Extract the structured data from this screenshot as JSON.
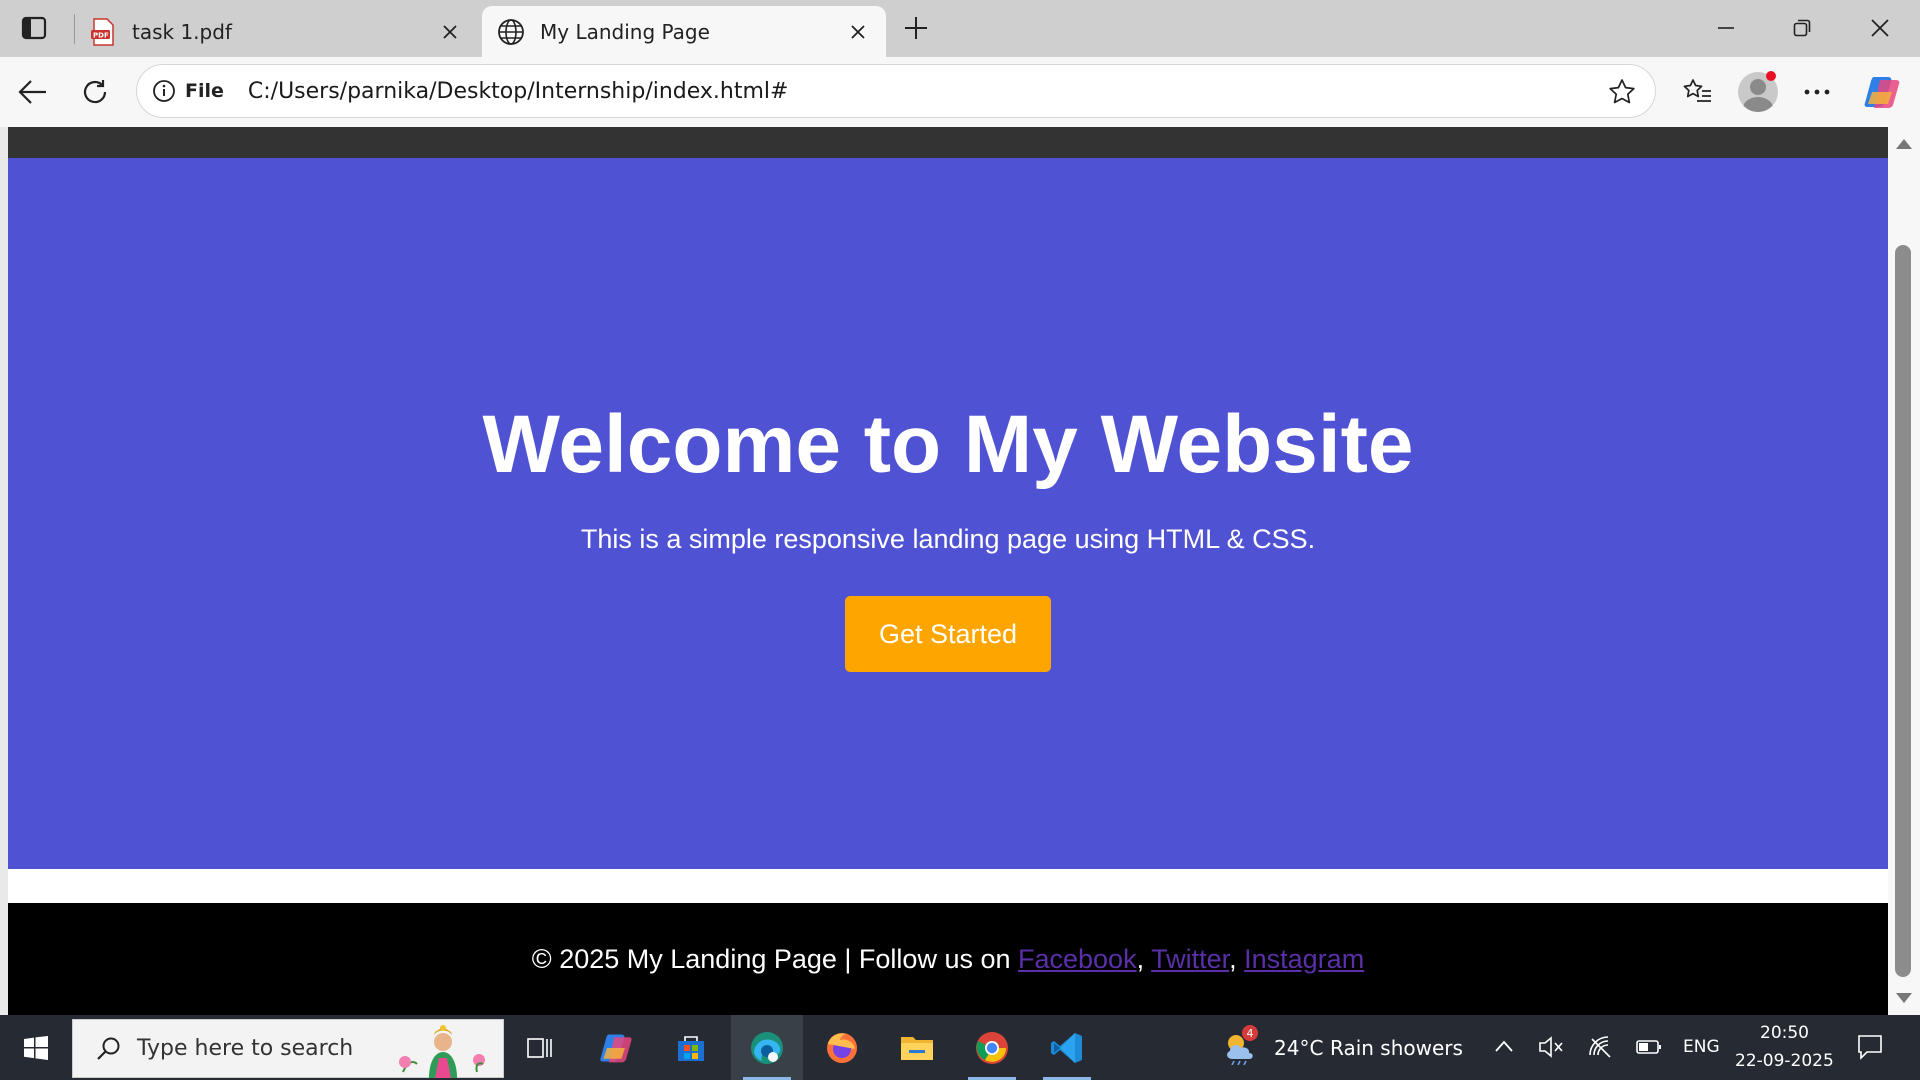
{
  "browser": {
    "tabs": [
      {
        "title": "task 1.pdf",
        "icon": "pdf-icon",
        "active": false
      },
      {
        "title": "My Landing Page",
        "icon": "globe-icon",
        "active": true
      }
    ],
    "address": {
      "scheme_label": "File",
      "url": "C:/Users/parnika/Desktop/Internship/index.html#"
    }
  },
  "page": {
    "hero": {
      "title": "Welcome to My Website",
      "subtitle": "This is a simple responsive landing page using HTML & CSS.",
      "cta_label": "Get Started"
    },
    "footer": {
      "text_prefix": "© 2025 My Landing Page | Follow us on ",
      "links": [
        "Facebook",
        "Twitter",
        "Instagram"
      ],
      "separator": ", "
    },
    "colors": {
      "nav": "#333333",
      "hero_bg": "#5052d4",
      "cta_bg": "#ffa500",
      "footer_bg": "#000000",
      "link": "#5a2fa8"
    }
  },
  "taskbar": {
    "search_placeholder": "Type here to search",
    "weather": {
      "temp": "24°C",
      "desc": "Rain showers",
      "badge": "4"
    },
    "language": "ENG",
    "time": "20:50",
    "date": "22-09-2025"
  }
}
